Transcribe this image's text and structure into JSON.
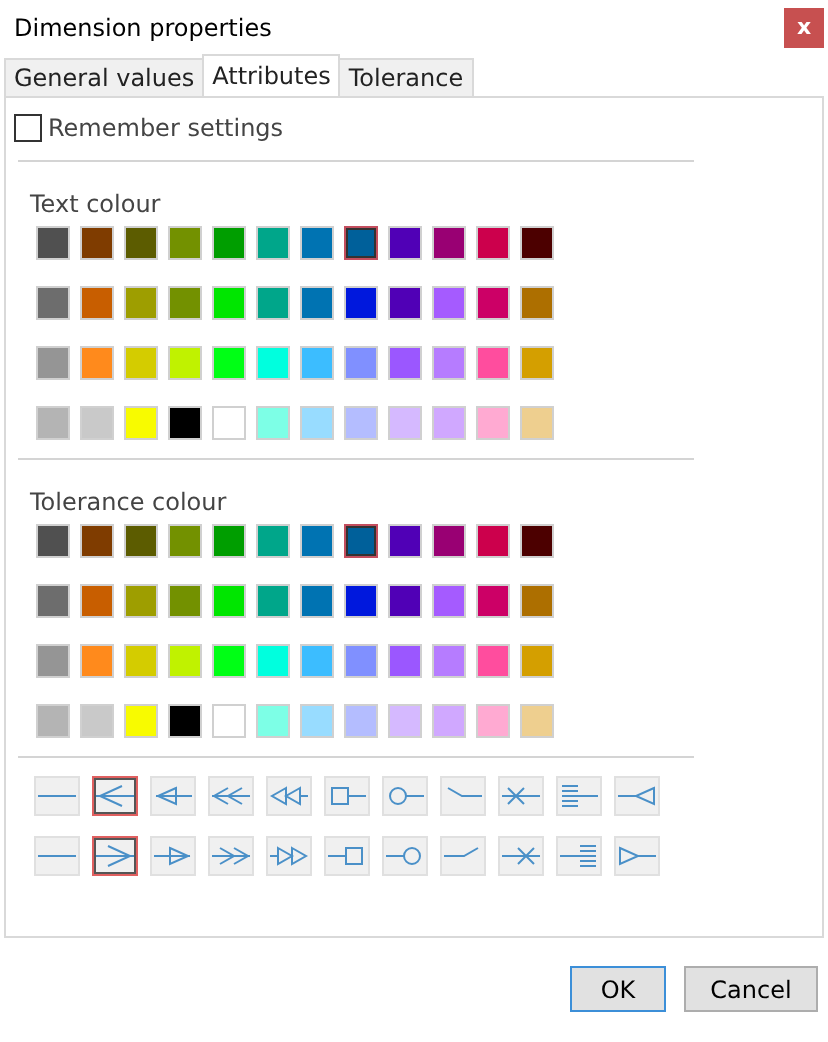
{
  "window": {
    "title": "Dimension properties",
    "close_label": "x"
  },
  "tabs": [
    {
      "label": "General values",
      "selected": false
    },
    {
      "label": "Attributes",
      "selected": true
    },
    {
      "label": "Tolerance",
      "selected": false
    }
  ],
  "remember_settings": {
    "label": "Remember settings",
    "checked": false
  },
  "palettes": [
    {
      "label": "Text colour",
      "rows": [
        {
          "swatches": [
            {
              "color": "#505050",
              "selected": false
            },
            {
              "color": "#7f3c00",
              "selected": false
            },
            {
              "color": "#5c5c00",
              "selected": false
            },
            {
              "color": "#739100",
              "selected": false
            },
            {
              "color": "#009e00",
              "selected": false
            },
            {
              "color": "#00a68a",
              "selected": false
            },
            {
              "color": "#0073b2",
              "selected": false
            },
            {
              "color": "#00609a",
              "selected": true
            },
            {
              "color": "#5000b6",
              "selected": false
            },
            {
              "color": "#990073",
              "selected": false
            },
            {
              "color": "#cc004c",
              "selected": false
            },
            {
              "color": "#4c0000",
              "selected": false
            }
          ]
        },
        {
          "swatches": [
            {
              "color": "#6d6d6d",
              "selected": false
            },
            {
              "color": "#c85e00",
              "selected": false
            },
            {
              "color": "#9e9e00",
              "selected": false
            },
            {
              "color": "#739100",
              "selected": false
            },
            {
              "color": "#00e600",
              "selected": false
            },
            {
              "color": "#00a68a",
              "selected": false
            },
            {
              "color": "#0073b2",
              "selected": false
            },
            {
              "color": "#0018dd",
              "selected": false
            },
            {
              "color": "#5000b6",
              "selected": false
            },
            {
              "color": "#a55bff",
              "selected": false
            },
            {
              "color": "#cc0066",
              "selected": false
            },
            {
              "color": "#ad6f00",
              "selected": false
            }
          ]
        },
        {
          "swatches": [
            {
              "color": "#959595",
              "selected": false
            },
            {
              "color": "#ff8a1c",
              "selected": false
            },
            {
              "color": "#d4cc00",
              "selected": false
            },
            {
              "color": "#c0f200",
              "selected": false
            },
            {
              "color": "#00ff15",
              "selected": false
            },
            {
              "color": "#00ffde",
              "selected": false
            },
            {
              "color": "#3cbdff",
              "selected": false
            },
            {
              "color": "#8090ff",
              "selected": false
            },
            {
              "color": "#9b57ff",
              "selected": false
            },
            {
              "color": "#b67cff",
              "selected": false
            },
            {
              "color": "#ff4d9e",
              "selected": false
            },
            {
              "color": "#d49f00",
              "selected": false
            }
          ]
        },
        {
          "swatches": [
            {
              "color": "#b4b4b4",
              "selected": false
            },
            {
              "color": "#c9c9c9",
              "selected": false
            },
            {
              "color": "#f8fb00",
              "selected": false
            },
            {
              "color": "#000000",
              "selected": false
            },
            {
              "color": "#ffffff",
              "selected": false
            },
            {
              "color": "#7dffe6",
              "selected": false
            },
            {
              "color": "#98dcff",
              "selected": false
            },
            {
              "color": "#b4bdff",
              "selected": false
            },
            {
              "color": "#d5b9ff",
              "selected": false
            },
            {
              "color": "#d0a8ff",
              "selected": false
            },
            {
              "color": "#ffaad2",
              "selected": false
            },
            {
              "color": "#eecf8f",
              "selected": false
            }
          ]
        }
      ]
    },
    {
      "label": "Tolerance colour",
      "rows": [
        {
          "swatches": [
            {
              "color": "#505050",
              "selected": false
            },
            {
              "color": "#7f3c00",
              "selected": false
            },
            {
              "color": "#5c5c00",
              "selected": false
            },
            {
              "color": "#739100",
              "selected": false
            },
            {
              "color": "#009e00",
              "selected": false
            },
            {
              "color": "#00a68a",
              "selected": false
            },
            {
              "color": "#0073b2",
              "selected": false
            },
            {
              "color": "#00609a",
              "selected": true
            },
            {
              "color": "#5000b6",
              "selected": false
            },
            {
              "color": "#990073",
              "selected": false
            },
            {
              "color": "#cc004c",
              "selected": false
            },
            {
              "color": "#4c0000",
              "selected": false
            }
          ]
        },
        {
          "swatches": [
            {
              "color": "#6d6d6d",
              "selected": false
            },
            {
              "color": "#c85e00",
              "selected": false
            },
            {
              "color": "#9e9e00",
              "selected": false
            },
            {
              "color": "#739100",
              "selected": false
            },
            {
              "color": "#00e600",
              "selected": false
            },
            {
              "color": "#00a68a",
              "selected": false
            },
            {
              "color": "#0073b2",
              "selected": false
            },
            {
              "color": "#0018dd",
              "selected": false
            },
            {
              "color": "#5000b6",
              "selected": false
            },
            {
              "color": "#a55bff",
              "selected": false
            },
            {
              "color": "#cc0066",
              "selected": false
            },
            {
              "color": "#ad6f00",
              "selected": false
            }
          ]
        },
        {
          "swatches": [
            {
              "color": "#959595",
              "selected": false
            },
            {
              "color": "#ff8a1c",
              "selected": false
            },
            {
              "color": "#d4cc00",
              "selected": false
            },
            {
              "color": "#c0f200",
              "selected": false
            },
            {
              "color": "#00ff15",
              "selected": false
            },
            {
              "color": "#00ffde",
              "selected": false
            },
            {
              "color": "#3cbdff",
              "selected": false
            },
            {
              "color": "#8090ff",
              "selected": false
            },
            {
              "color": "#9b57ff",
              "selected": false
            },
            {
              "color": "#b67cff",
              "selected": false
            },
            {
              "color": "#ff4d9e",
              "selected": false
            },
            {
              "color": "#d49f00",
              "selected": false
            }
          ]
        },
        {
          "swatches": [
            {
              "color": "#b4b4b4",
              "selected": false
            },
            {
              "color": "#c9c9c9",
              "selected": false
            },
            {
              "color": "#f8fb00",
              "selected": false
            },
            {
              "color": "#000000",
              "selected": false
            },
            {
              "color": "#ffffff",
              "selected": false
            },
            {
              "color": "#7dffe6",
              "selected": false
            },
            {
              "color": "#98dcff",
              "selected": false
            },
            {
              "color": "#b4bdff",
              "selected": false
            },
            {
              "color": "#d5b9ff",
              "selected": false
            },
            {
              "color": "#d0a8ff",
              "selected": false
            },
            {
              "color": "#ffaad2",
              "selected": false
            },
            {
              "color": "#eecf8f",
              "selected": false
            }
          ]
        }
      ]
    }
  ],
  "line_end_styles": [
    {
      "kind": "left",
      "styles": [
        {
          "kind": "plain",
          "selected": false
        },
        {
          "kind": "open-arrow",
          "selected": true
        },
        {
          "kind": "closed-arrow",
          "selected": false
        },
        {
          "kind": "double-open-arrow",
          "selected": false
        },
        {
          "kind": "double-closed-arrow",
          "selected": false
        },
        {
          "kind": "square",
          "selected": false
        },
        {
          "kind": "circle",
          "selected": false
        },
        {
          "kind": "slash",
          "selected": false
        },
        {
          "kind": "cross",
          "selected": false
        },
        {
          "kind": "bars",
          "selected": false
        },
        {
          "kind": "reverse-arrow",
          "selected": false
        }
      ]
    },
    {
      "kind": "right",
      "styles": [
        {
          "kind": "plain",
          "selected": false
        },
        {
          "kind": "open-arrow",
          "selected": true
        },
        {
          "kind": "closed-arrow",
          "selected": false
        },
        {
          "kind": "double-open-arrow",
          "selected": false
        },
        {
          "kind": "double-closed-arrow",
          "selected": false
        },
        {
          "kind": "square",
          "selected": false
        },
        {
          "kind": "circle",
          "selected": false
        },
        {
          "kind": "slash",
          "selected": false
        },
        {
          "kind": "cross",
          "selected": false
        },
        {
          "kind": "bars",
          "selected": false
        },
        {
          "kind": "reverse-arrow",
          "selected": false
        }
      ]
    }
  ],
  "buttons": [
    {
      "label": "OK",
      "default": true
    },
    {
      "label": "Cancel",
      "default": false
    }
  ]
}
